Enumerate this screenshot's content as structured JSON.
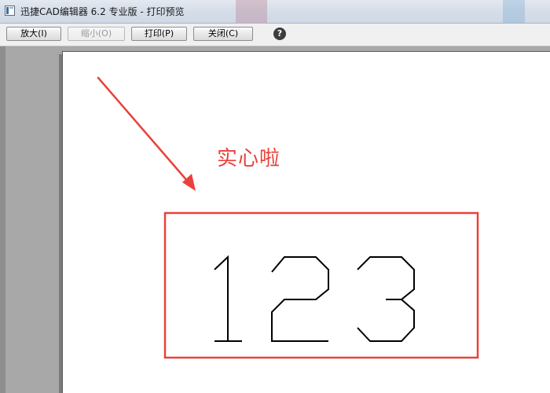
{
  "window": {
    "title": "迅捷CAD编辑器 6.2 专业版  - 打印预览"
  },
  "toolbar": {
    "zoom_in_label": "放大(I)",
    "zoom_out_label": "缩小(O)",
    "print_label": "打印(P)",
    "close_label": "关闭(C)",
    "help_glyph": "?"
  },
  "preview": {
    "annotation": "实心啦",
    "drawing_text": "123"
  },
  "colors": {
    "annotation_red": "#e8423a",
    "drawing_stroke": "#000000",
    "paper": "#ffffff",
    "workspace": "#a8a8a8"
  },
  "icons": {
    "app": "app-icon",
    "help": "help-icon"
  }
}
